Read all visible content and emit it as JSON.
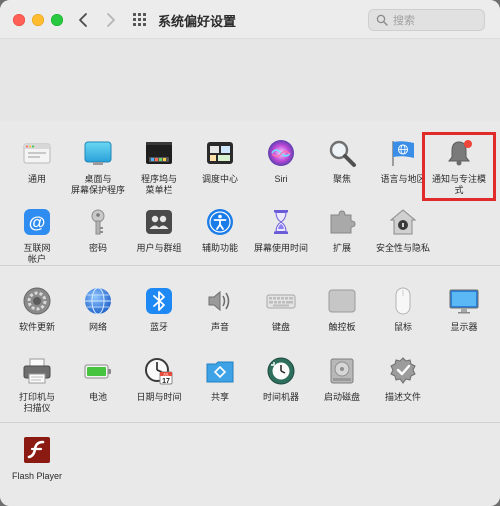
{
  "window": {
    "title": "系统偏好设置",
    "search_placeholder": "搜索"
  },
  "section1": [
    {
      "label": "通用",
      "icon": "general-icon"
    },
    {
      "label": "桌面与\n屏幕保护程序",
      "icon": "desktop-screensaver-icon"
    },
    {
      "label": "程序坞与\n菜单栏",
      "icon": "dock-menubar-icon"
    },
    {
      "label": "调度中心",
      "icon": "mission-control-icon"
    },
    {
      "label": "Siri",
      "icon": "siri-icon"
    },
    {
      "label": "聚焦",
      "icon": "spotlight-icon"
    },
    {
      "label": "语言与地区",
      "icon": "language-region-icon"
    },
    {
      "label": "通知与专注模式",
      "icon": "notifications-focus-icon"
    },
    {
      "label": "互联网\n帐户",
      "icon": "internet-accounts-icon"
    },
    {
      "label": "密码",
      "icon": "passwords-icon"
    },
    {
      "label": "用户与群组",
      "icon": "users-groups-icon"
    },
    {
      "label": "辅助功能",
      "icon": "accessibility-icon"
    },
    {
      "label": "屏幕使用时间",
      "icon": "screen-time-icon"
    },
    {
      "label": "扩展",
      "icon": "extensions-icon"
    },
    {
      "label": "安全性与隐私",
      "icon": "security-privacy-icon"
    }
  ],
  "section2": [
    {
      "label": "软件更新",
      "icon": "software-update-icon"
    },
    {
      "label": "网络",
      "icon": "network-icon"
    },
    {
      "label": "蓝牙",
      "icon": "bluetooth-icon"
    },
    {
      "label": "声音",
      "icon": "sound-icon"
    },
    {
      "label": "键盘",
      "icon": "keyboard-icon"
    },
    {
      "label": "触控板",
      "icon": "trackpad-icon"
    },
    {
      "label": "鼠标",
      "icon": "mouse-icon"
    },
    {
      "label": "显示器",
      "icon": "displays-icon"
    },
    {
      "label": "打印机与\n扫描仪",
      "icon": "printers-scanners-icon"
    },
    {
      "label": "电池",
      "icon": "battery-icon"
    },
    {
      "label": "日期与时间",
      "icon": "date-time-icon"
    },
    {
      "label": "共享",
      "icon": "sharing-icon"
    },
    {
      "label": "时间机器",
      "icon": "time-machine-icon"
    },
    {
      "label": "启动磁盘",
      "icon": "startup-disk-icon"
    },
    {
      "label": "描述文件",
      "icon": "profiles-icon"
    }
  ],
  "section3": [
    {
      "label": "Flash Player",
      "icon": "flash-player-icon"
    }
  ],
  "calendar_icon_text": {
    "month": "JUL",
    "day": "17"
  },
  "notification_badge": true,
  "colors": {
    "highlight_border": "#e12a2a",
    "close": "#fe5f57",
    "minimize": "#febc2e",
    "maximize": "#28c840"
  }
}
